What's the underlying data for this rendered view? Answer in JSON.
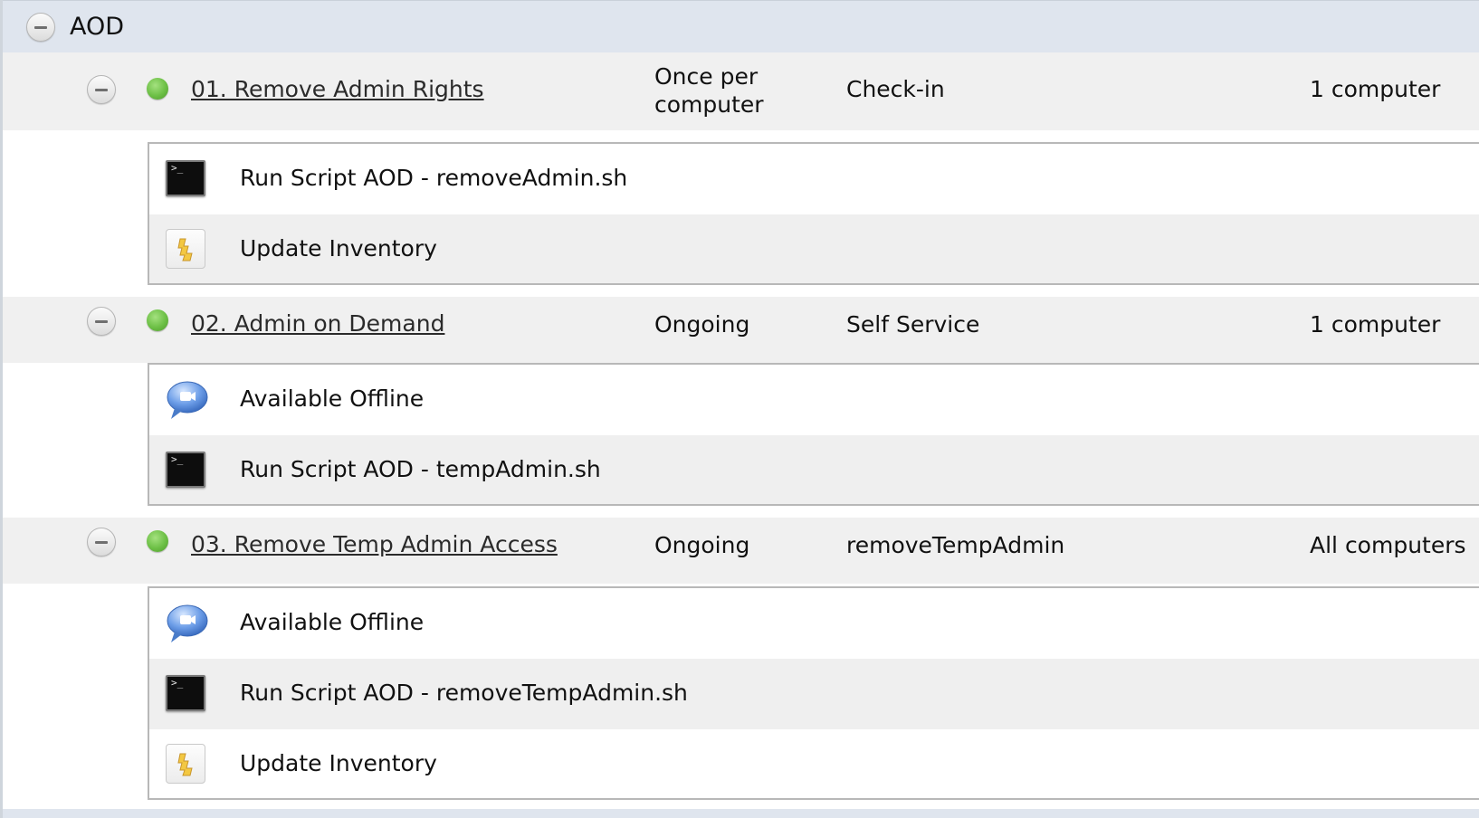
{
  "category": {
    "title": "AOD"
  },
  "policies": [
    {
      "name": "01. Remove Admin Rights",
      "frequency": "Once per computer",
      "trigger": "Check-in",
      "scope": "1 computer",
      "status_color": "#6cbf45",
      "payloads": [
        {
          "icon": "terminal-icon",
          "label": "Run Script AOD - removeAdmin.sh"
        },
        {
          "icon": "inventory-icon",
          "label": "Update Inventory"
        }
      ]
    },
    {
      "name": "02. Admin on Demand",
      "frequency": "Ongoing",
      "trigger": "Self Service",
      "scope": "1 computer",
      "status_color": "#6cbf45",
      "payloads": [
        {
          "icon": "chat-bubble-icon",
          "label": "Available Offline"
        },
        {
          "icon": "terminal-icon",
          "label": "Run Script AOD - tempAdmin.sh"
        }
      ]
    },
    {
      "name": "03. Remove Temp Admin Access",
      "frequency": "Ongoing",
      "trigger": "removeTempAdmin",
      "scope": "All computers",
      "status_color": "#6cbf45",
      "payloads": [
        {
          "icon": "chat-bubble-icon",
          "label": "Available Offline"
        },
        {
          "icon": "terminal-icon",
          "label": "Run Script AOD - removeTempAdmin.sh"
        },
        {
          "icon": "inventory-icon",
          "label": "Update Inventory"
        }
      ]
    }
  ]
}
